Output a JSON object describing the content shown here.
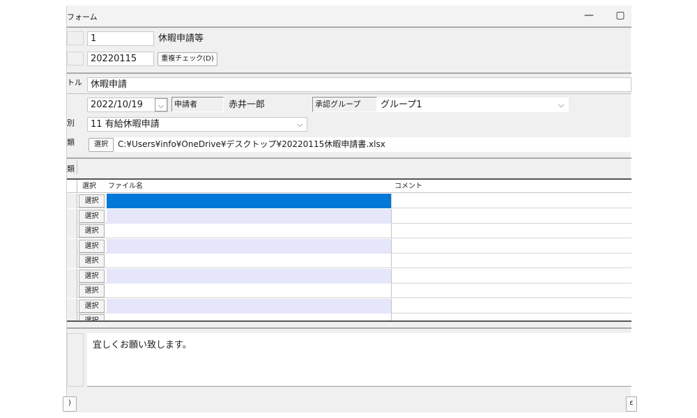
{
  "window": {
    "title": "フォーム",
    "minimize_glyph": "—",
    "maximize_glyph": "▢"
  },
  "form": {
    "id_value": "1",
    "type_name": "休暇申請等",
    "date_code": "20220115",
    "dup_check_label": "重複チェック(D)",
    "title_label": "トル",
    "title_value": "休暇申請",
    "apply_date": "2022/10/19",
    "applicant_label": "申請者",
    "applicant_name": "赤井一郎",
    "approval_group_label": "承認グループ",
    "approval_group_value": "グループ1",
    "category_label": "別",
    "category_value": "11  有給休暇申請",
    "file_label": "類",
    "select_button": "選択",
    "file_path": "C:¥Users¥info¥OneDrive¥デスクトップ¥20220115休暇申請書.xlsx",
    "attach_label": "類"
  },
  "grid": {
    "columns": [
      "選択",
      "ファイル名",
      "コメント"
    ],
    "rows": [
      {
        "select": "選択",
        "file": "",
        "comment": ""
      },
      {
        "select": "選択",
        "file": "",
        "comment": ""
      },
      {
        "select": "選択",
        "file": "",
        "comment": ""
      },
      {
        "select": "選択",
        "file": "",
        "comment": ""
      },
      {
        "select": "選択",
        "file": "",
        "comment": ""
      },
      {
        "select": "選択",
        "file": "",
        "comment": ""
      },
      {
        "select": "選択",
        "file": "",
        "comment": ""
      },
      {
        "select": "選択",
        "file": "",
        "comment": ""
      },
      {
        "select": "選択",
        "file": "",
        "comment": ""
      }
    ]
  },
  "memo": {
    "text": "宜しくお願い致します。"
  },
  "footer": {
    "left_text": ")",
    "right_text": "ε"
  },
  "colors": {
    "selected_cell": "#0078d7",
    "alt_row": "#e6e6fa",
    "background": "#f0f0f0"
  }
}
